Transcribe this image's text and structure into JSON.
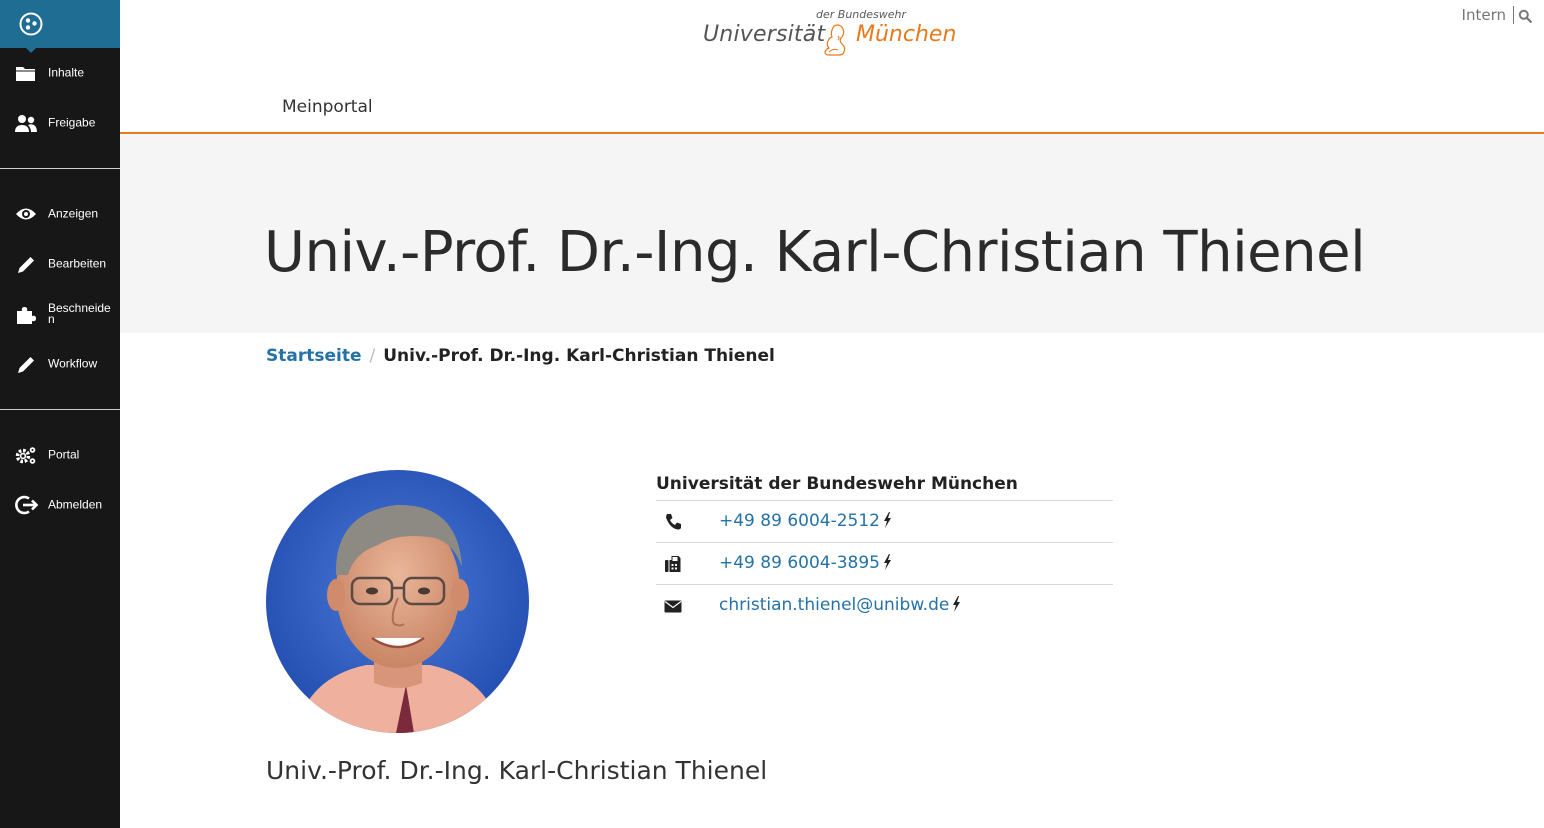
{
  "sidebar": {
    "items": [
      {
        "label": "Inhalte",
        "icon": "folder-icon"
      },
      {
        "label": "Freigabe",
        "icon": "users-icon"
      },
      {
        "label": "Anzeigen",
        "icon": "eye-icon"
      },
      {
        "label": "Bearbeiten",
        "icon": "pencil-icon"
      },
      {
        "label": "Beschneiden",
        "icon": "puzzle-icon"
      },
      {
        "label": "Workflow",
        "icon": "pencil-icon"
      },
      {
        "label": "Portal",
        "icon": "gears-icon"
      },
      {
        "label": "Abmelden",
        "icon": "logout-icon"
      }
    ]
  },
  "header": {
    "brand_small": "der Bundeswehr",
    "brand_left": "Universität",
    "brand_right": "München",
    "intern_label": "Intern",
    "nav_item": "Meinportal"
  },
  "page": {
    "title": "Univ.-Prof. Dr.-Ing. Karl-Christian Thienel"
  },
  "breadcrumb": {
    "home": "Startseite",
    "separator": "/",
    "current": "Univ.-Prof. Dr.-Ing. Karl-Christian Thienel"
  },
  "person": {
    "name": "Univ.-Prof. Dr.-Ing. Karl-Christian Thienel"
  },
  "contact": {
    "organization": "Universität der Bundeswehr München",
    "rows": [
      {
        "icon": "phone-icon",
        "value": "+49 89 6004-2512"
      },
      {
        "icon": "fax-icon",
        "value": "+49 89 6004-3895"
      },
      {
        "icon": "envelope-icon",
        "value": "christian.thienel@unibw.de"
      }
    ]
  },
  "colors": {
    "accent_orange": "#e77a1d",
    "link_blue": "#2472a8",
    "sidebar_bg": "#171717",
    "sidebar_logo_bg": "#1f6d93"
  }
}
